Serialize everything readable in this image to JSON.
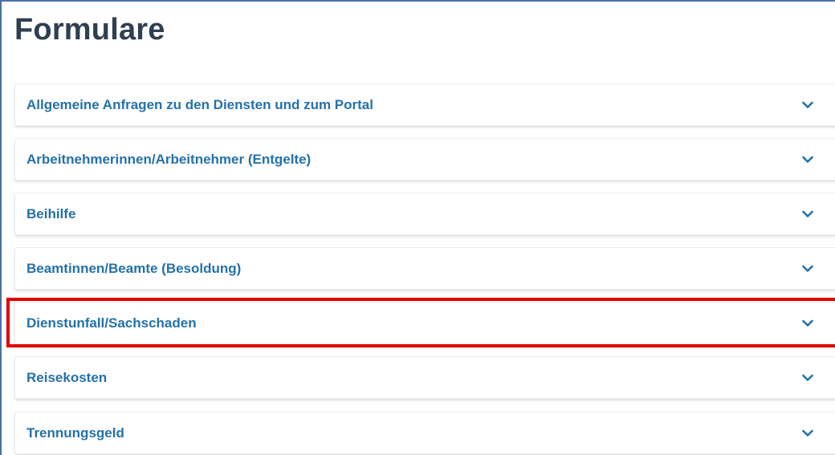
{
  "page": {
    "title": "Formulare"
  },
  "accordion": {
    "items": [
      {
        "label": "Allgemeine Anfragen zu den Diensten und zum Portal"
      },
      {
        "label": "Arbeitnehmerinnen/Arbeitnehmer (Entgelte)"
      },
      {
        "label": "Beihilfe"
      },
      {
        "label": "Beamtinnen/Beamte (Besoldung)"
      },
      {
        "label": "Dienstunfall/Sachschaden",
        "highlighted": true
      },
      {
        "label": "Reisekosten"
      },
      {
        "label": "Trennungsgeld"
      }
    ],
    "chevron_icon": "chevron-down-icon"
  },
  "colors": {
    "title": "#2f3f52",
    "link": "#2471a9",
    "highlight": "#e00000"
  }
}
